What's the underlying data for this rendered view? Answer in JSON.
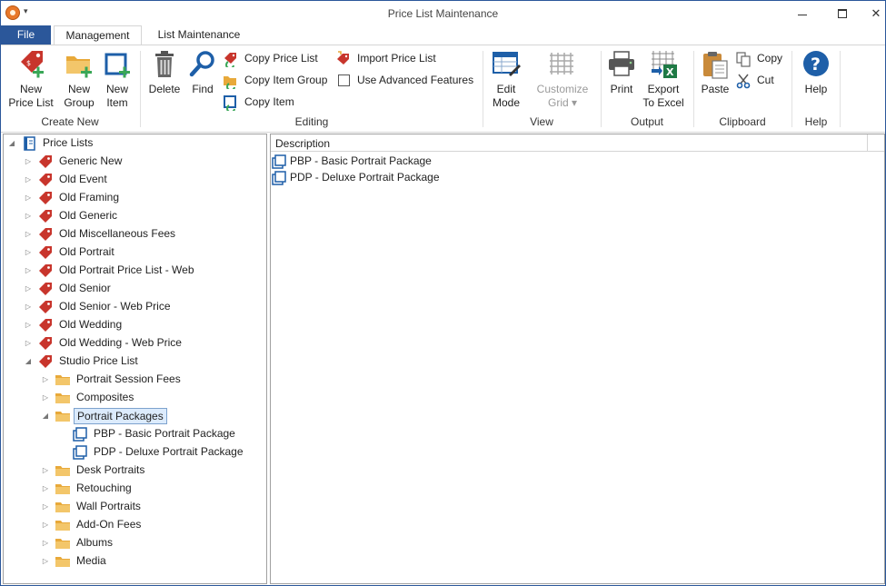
{
  "window": {
    "title": "Price List Maintenance"
  },
  "tabs": {
    "file": "File",
    "management": "Management",
    "list_maintenance": "List Maintenance"
  },
  "ribbon": {
    "create_new": {
      "label": "Create New",
      "new_price_list": "New\nPrice List",
      "new_group": "New\nGroup",
      "new_item": "New\nItem"
    },
    "editing": {
      "label": "Editing",
      "delete": "Delete",
      "find": "Find",
      "copy_price_list": "Copy Price List",
      "copy_item_group": "Copy Item Group",
      "copy_item": "Copy Item",
      "import_price_list": "Import Price List",
      "use_advanced_features": "Use Advanced Features"
    },
    "view": {
      "label": "View",
      "edit_mode": "Edit\nMode",
      "customize_grid": "Customize\nGrid ▾"
    },
    "output": {
      "label": "Output",
      "print": "Print",
      "export_to_excel": "Export\nTo Excel"
    },
    "clipboard": {
      "label": "Clipboard",
      "paste": "Paste",
      "copy": "Copy",
      "cut": "Cut"
    },
    "help": {
      "label": "Help",
      "help": "Help"
    }
  },
  "tree": {
    "root": "Price Lists",
    "price_lists": [
      "Generic New",
      "Old Event",
      "Old Framing",
      "Old Generic",
      "Old Miscellaneous Fees",
      "Old Portrait",
      "Old Portrait Price List - Web",
      "Old Senior",
      "Old Senior  - Web Price",
      "Old Wedding",
      "Old Wedding  - Web Price",
      "Studio Price List"
    ],
    "studio_groups": [
      "Portrait Session Fees",
      "Composites",
      "Portrait Packages",
      "Desk Portraits",
      "Retouching",
      "Wall Portraits",
      "Add-On Fees",
      "Albums",
      "Media"
    ],
    "package_items": [
      "PBP - Basic Portrait Package",
      "PDP - Deluxe Portrait Package"
    ]
  },
  "list": {
    "column_description": "Description",
    "rows": [
      "PBP - Basic Portrait Package",
      "PDP - Deluxe Portrait Package"
    ]
  },
  "colors": {
    "accent": "#2b579a",
    "tag_red": "#c8352c",
    "folder": "#f0c060"
  }
}
